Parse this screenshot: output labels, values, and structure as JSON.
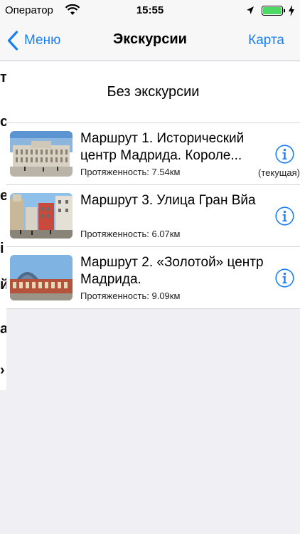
{
  "status_bar": {
    "carrier": "Оператор",
    "time": "15:55",
    "battery_color": "#4cd964"
  },
  "nav": {
    "back_label": "Меню",
    "title": "Экскурсии",
    "right_label": "Карта",
    "tint": "#1a7ff5"
  },
  "no_tour_label": "Без экскурсии",
  "routes": [
    {
      "title": "Маршрут 1. Исторический центр Мадрида. Короле...",
      "distance": "Протяженность: 7.54км",
      "current_label": "(текущая)",
      "image": "royal-palace-photo"
    },
    {
      "title": "Маршрут 3. Улица Гран Вйа",
      "distance": "Протяженность: 6.07км",
      "image": "gran-via-photo"
    },
    {
      "title": "Маршрут 2. «Золотой» центр Мадрида.",
      "distance": "Протяженность: 9.09км",
      "image": "atocha-station-photo"
    }
  ],
  "underlay_marks": [
    "т",
    "с",
    "е",
    "і",
    "й",
    "а",
    "›"
  ]
}
